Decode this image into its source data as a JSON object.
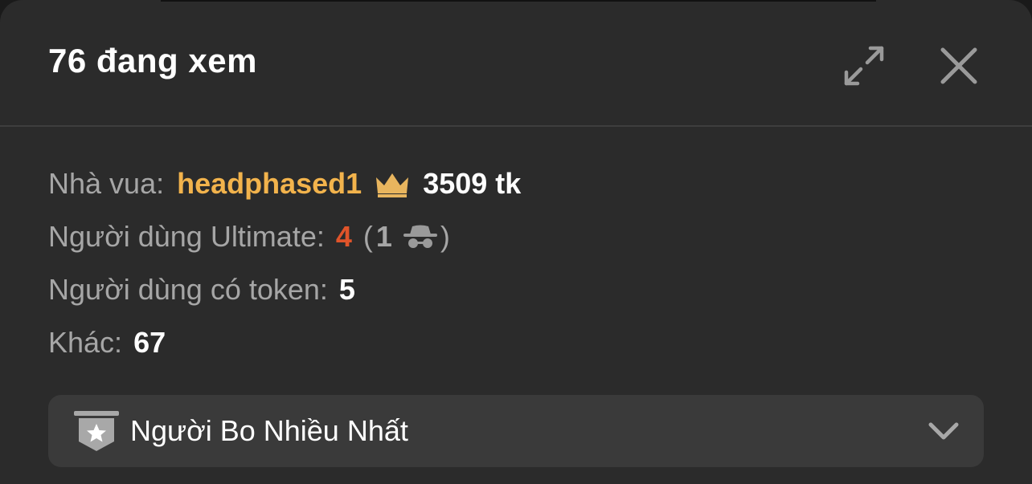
{
  "header": {
    "title": "76 đang xem",
    "expand_icon": "expand-arrows-icon",
    "close_icon": "close-icon"
  },
  "stats": {
    "king": {
      "label": "Nhà vua:",
      "username": "headphased1",
      "icon": "crown-icon",
      "tokens": "3509 tk"
    },
    "ultimate": {
      "label": "Người dùng Ultimate:",
      "count": "4",
      "open_paren": "(",
      "anonymous_count": "1",
      "anonymous_icon": "spy-incognito-icon",
      "close_paren": ")"
    },
    "token_users": {
      "label": "Người dùng có token:",
      "count": "5"
    },
    "other": {
      "label": "Khác:",
      "count": "67"
    }
  },
  "dropdown": {
    "icon": "star-badge-icon",
    "label": "Người Bo Nhiều Nhất",
    "chevron": "chevron-down-icon"
  },
  "colors": {
    "panel_bg": "#2b2b2b",
    "king_name": "#f2b34c",
    "crown": "#e8b55e",
    "ultimate_count": "#e0542a",
    "muted_text": "#a6a6a6",
    "dropdown_bg": "#3a3a3a"
  }
}
